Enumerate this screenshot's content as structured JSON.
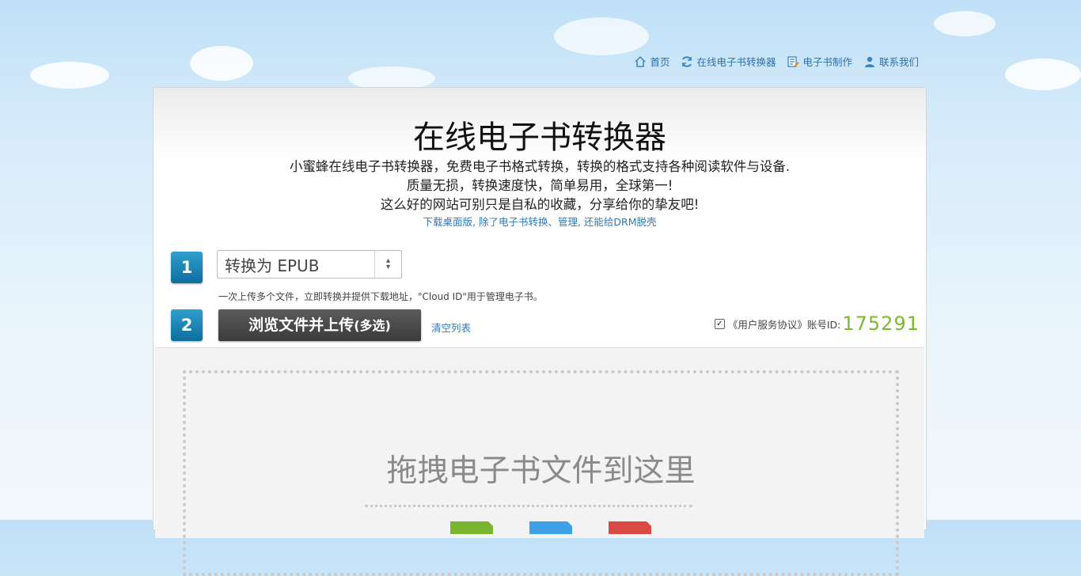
{
  "nav": {
    "items": [
      {
        "label": "首页",
        "icon": "home-icon"
      },
      {
        "label": "在线电子书转换器",
        "icon": "refresh-icon"
      },
      {
        "label": "电子书制作",
        "icon": "document-edit-icon"
      },
      {
        "label": "联系我们",
        "icon": "user-icon"
      }
    ]
  },
  "header": {
    "title": "在线电子书转换器",
    "desc_lines": [
      "小蜜蜂在线电子书转换器，免费电子书格式转换，转换的格式支持各种阅读软件与设备.",
      "质量无损，转换速度快，简单易用，全球第一!",
      "这么好的网站可别只是自私的收藏，分享给你的挚友吧!"
    ],
    "desktop_link": "下载桌面版, 除了电子书转换、管理, 还能给DRM脱壳"
  },
  "step1": {
    "number": "1",
    "select_value": "转换为 EPUB",
    "hint": "一次上传多个文件，立即转换并提供下载地址，\"Cloud ID\"用于管理电子书。"
  },
  "step2": {
    "number": "2",
    "upload_label": "浏览文件并上传",
    "upload_suffix": "(多选)",
    "clear_label": "清空列表",
    "agreement": "《用户服务协议》账号ID:",
    "account_id": "175291"
  },
  "dropzone": {
    "text": "拖拽电子书文件到这里"
  },
  "colors": {
    "accent_blue": "#2f78b8",
    "step_blue": "#1a86b8",
    "account_green": "#7cb82f",
    "format_green": "#7ab530",
    "format_blue": "#3fa1e6",
    "format_red": "#d84a43"
  }
}
